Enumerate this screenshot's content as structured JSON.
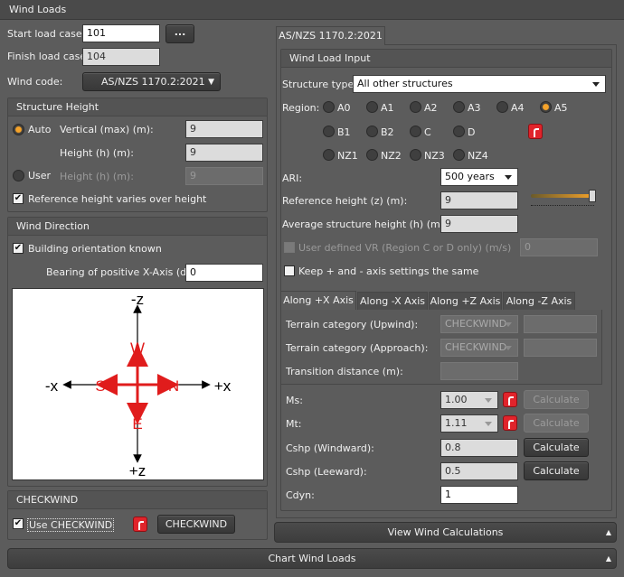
{
  "title": "Wind Loads",
  "start_load_case": {
    "label": "Start load case:",
    "value": "101",
    "browse_label": "..."
  },
  "finish_load_case": {
    "label": "Finish load case:",
    "value": "104"
  },
  "wind_code": {
    "label": "Wind code:",
    "value": "AS/NZS 1170.2:2021"
  },
  "structure_height": {
    "header": "Structure Height",
    "auto_label": "Auto",
    "user_label": "User",
    "vertical_label": "Vertical (max) (m):",
    "vertical_value": "9",
    "height_label": "Height (h) (m):",
    "height_value": "9",
    "user_height_label": "Height (h) (m):",
    "user_height_value": "9",
    "ref_varies_label": "Reference height varies over height"
  },
  "wind_direction": {
    "header": "Wind Direction",
    "orientation_label": "Building orientation known",
    "bearing_label": "Bearing of positive X-Axis (deg):",
    "bearing_value": "0",
    "compass": {
      "neg_z": "-z",
      "pos_z": "+z",
      "neg_x": "-x",
      "pos_x": "+x",
      "w": "W",
      "e": "E",
      "s": "S",
      "n": "N"
    }
  },
  "checkwind": {
    "header": "CHECKWIND",
    "use_label": "Use CHECKWIND",
    "button_label": "CHECKWIND"
  },
  "right_tab": "AS/NZS 1170.2:2021",
  "wind_load_input": {
    "header": "Wind Load Input",
    "structure_type_label": "Structure type:",
    "structure_type_value": "All other structures",
    "region_label": "Region:",
    "regions_row1": [
      "A0",
      "A1",
      "A2",
      "A3",
      "A4",
      "A5"
    ],
    "regions_row2": [
      "B1",
      "B2",
      "C",
      "D"
    ],
    "regions_row3": [
      "NZ1",
      "NZ2",
      "NZ3",
      "NZ4"
    ],
    "selected_region": "A5",
    "ari_label": "ARI:",
    "ari_value": "500 years",
    "ref_height_label": "Reference height (z) (m):",
    "ref_height_value": "9",
    "avg_height_label": "Average structure height (h) (m):",
    "avg_height_value": "9",
    "user_vr_label": "User defined VR (Region C or D only) (m/s)",
    "user_vr_value": "0",
    "keep_label": "Keep + and - axis settings the same"
  },
  "axis_tabs": [
    "Along +X Axis",
    "Along -X Axis",
    "Along +Z Axis",
    "Along -Z Axis"
  ],
  "axis": {
    "terrain_upwind_label": "Terrain category (Upwind):",
    "terrain_upwind_value": "CHECKWIND",
    "terrain_approach_label": "Terrain category (Approach):",
    "terrain_approach_value": "CHECKWIND",
    "transition_label": "Transition distance (m):",
    "ms_label": "Ms:",
    "ms_value": "1.00",
    "mt_label": "Mt:",
    "mt_value": "1.11",
    "cshp_w_label": "Cshp (Windward):",
    "cshp_w_value": "0.8",
    "cshp_l_label": "Cshp (Leeward):",
    "cshp_l_value": "0.5",
    "cdyn_label": "Cdyn:",
    "cdyn_value": "1",
    "calculate_label": "Calculate"
  },
  "view_calc_label": "View Wind Calculations",
  "chart_label": "Chart Wind Loads",
  "colors": {
    "accent": "#f5a32a",
    "lock": "#e0242b",
    "compass_red": "#e01c1c"
  }
}
